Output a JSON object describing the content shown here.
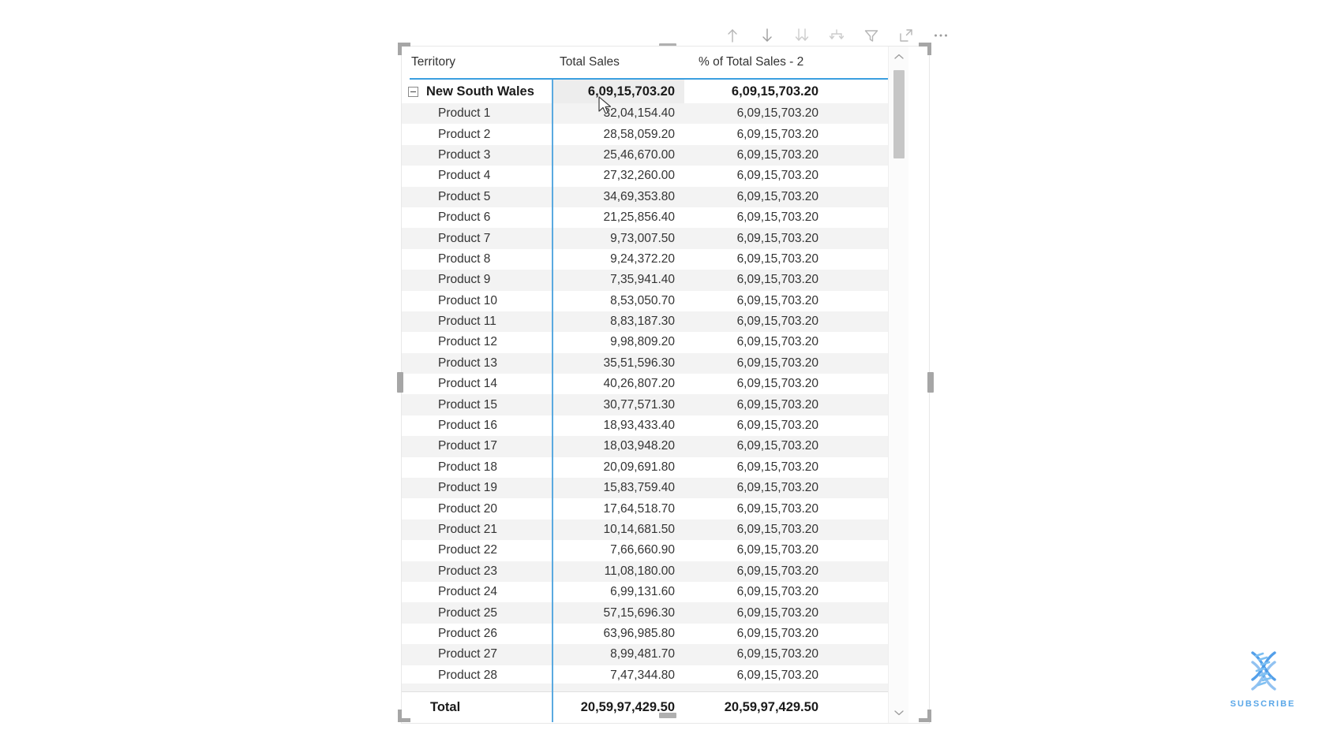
{
  "toolbar": {
    "buttons": [
      {
        "name": "drill-up-icon",
        "label": "Drill Up"
      },
      {
        "name": "drill-down-icon",
        "label": "Go to the next level in the hierarchy"
      },
      {
        "name": "expand-all-down-icon",
        "label": "Expand all down one level in the hierarchy"
      },
      {
        "name": "drill-mode-icon",
        "label": "Drill on"
      },
      {
        "name": "filter-icon",
        "label": "Filters"
      },
      {
        "name": "focus-mode-icon",
        "label": "Focus mode"
      },
      {
        "name": "more-options-icon",
        "label": "More options"
      }
    ],
    "more_options_glyph": "···"
  },
  "visual": {
    "type": "matrix",
    "columns": [
      "Territory",
      "Total Sales",
      "% of Total Sales - 2"
    ],
    "group": {
      "expander_state": "expanded",
      "label": "New South Wales",
      "total_sales": "6,09,15,703.20",
      "pct_of_total_sales_2": "6,09,15,703.20"
    },
    "rows": [
      {
        "territory": "Product 1",
        "total_sales": "32,04,154.40",
        "pct_of_total_sales_2": "6,09,15,703.20"
      },
      {
        "territory": "Product 2",
        "total_sales": "28,58,059.20",
        "pct_of_total_sales_2": "6,09,15,703.20"
      },
      {
        "territory": "Product 3",
        "total_sales": "25,46,670.00",
        "pct_of_total_sales_2": "6,09,15,703.20"
      },
      {
        "territory": "Product 4",
        "total_sales": "27,32,260.00",
        "pct_of_total_sales_2": "6,09,15,703.20"
      },
      {
        "territory": "Product 5",
        "total_sales": "34,69,353.80",
        "pct_of_total_sales_2": "6,09,15,703.20"
      },
      {
        "territory": "Product 6",
        "total_sales": "21,25,856.40",
        "pct_of_total_sales_2": "6,09,15,703.20"
      },
      {
        "territory": "Product 7",
        "total_sales": "9,73,007.50",
        "pct_of_total_sales_2": "6,09,15,703.20"
      },
      {
        "territory": "Product 8",
        "total_sales": "9,24,372.20",
        "pct_of_total_sales_2": "6,09,15,703.20"
      },
      {
        "territory": "Product 9",
        "total_sales": "7,35,941.40",
        "pct_of_total_sales_2": "6,09,15,703.20"
      },
      {
        "territory": "Product 10",
        "total_sales": "8,53,050.70",
        "pct_of_total_sales_2": "6,09,15,703.20"
      },
      {
        "territory": "Product 11",
        "total_sales": "8,83,187.30",
        "pct_of_total_sales_2": "6,09,15,703.20"
      },
      {
        "territory": "Product 12",
        "total_sales": "9,98,809.20",
        "pct_of_total_sales_2": "6,09,15,703.20"
      },
      {
        "territory": "Product 13",
        "total_sales": "35,51,596.30",
        "pct_of_total_sales_2": "6,09,15,703.20"
      },
      {
        "territory": "Product 14",
        "total_sales": "40,26,807.20",
        "pct_of_total_sales_2": "6,09,15,703.20"
      },
      {
        "territory": "Product 15",
        "total_sales": "30,77,571.30",
        "pct_of_total_sales_2": "6,09,15,703.20"
      },
      {
        "territory": "Product 16",
        "total_sales": "18,93,433.40",
        "pct_of_total_sales_2": "6,09,15,703.20"
      },
      {
        "territory": "Product 17",
        "total_sales": "18,03,948.20",
        "pct_of_total_sales_2": "6,09,15,703.20"
      },
      {
        "territory": "Product 18",
        "total_sales": "20,09,691.80",
        "pct_of_total_sales_2": "6,09,15,703.20"
      },
      {
        "territory": "Product 19",
        "total_sales": "15,83,759.40",
        "pct_of_total_sales_2": "6,09,15,703.20"
      },
      {
        "territory": "Product 20",
        "total_sales": "17,64,518.70",
        "pct_of_total_sales_2": "6,09,15,703.20"
      },
      {
        "territory": "Product 21",
        "total_sales": "10,14,681.50",
        "pct_of_total_sales_2": "6,09,15,703.20"
      },
      {
        "territory": "Product 22",
        "total_sales": "7,66,660.90",
        "pct_of_total_sales_2": "6,09,15,703.20"
      },
      {
        "territory": "Product 23",
        "total_sales": "11,08,180.00",
        "pct_of_total_sales_2": "6,09,15,703.20"
      },
      {
        "territory": "Product 24",
        "total_sales": "6,99,131.60",
        "pct_of_total_sales_2": "6,09,15,703.20"
      },
      {
        "territory": "Product 25",
        "total_sales": "57,15,696.30",
        "pct_of_total_sales_2": "6,09,15,703.20"
      },
      {
        "territory": "Product 26",
        "total_sales": "63,96,985.80",
        "pct_of_total_sales_2": "6,09,15,703.20"
      },
      {
        "territory": "Product 27",
        "total_sales": "8,99,481.70",
        "pct_of_total_sales_2": "6,09,15,703.20"
      },
      {
        "territory": "Product 28",
        "total_sales": "7,47,344.80",
        "pct_of_total_sales_2": "6,09,15,703.20"
      }
    ],
    "total": {
      "label": "Total",
      "total_sales": "20,59,97,429.50",
      "pct_of_total_sales_2": "20,59,97,429.50"
    }
  },
  "scrollbar": {
    "up_arrow": "⌃",
    "down_arrow": "⌄"
  },
  "watermark": {
    "label": "SUBSCRIBE",
    "icon": "dna-helix-icon"
  },
  "colors": {
    "accent_blue": "#3b9fe0",
    "column_divider": "#5aa9e0",
    "row_alt": "#f3f3f3",
    "text": "#333333",
    "watermark_blue": "#5aa7e8"
  }
}
